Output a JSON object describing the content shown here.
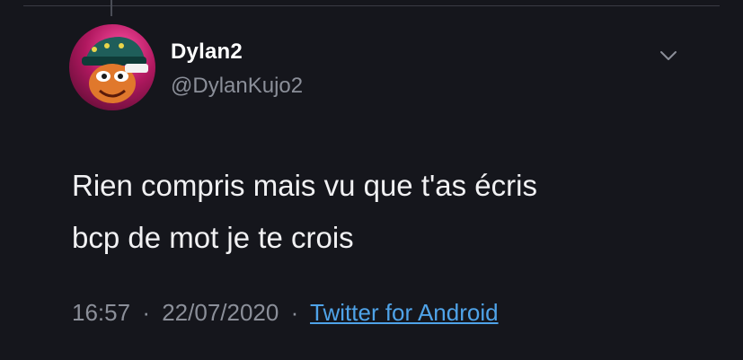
{
  "tweet": {
    "display_name": "Dylan2",
    "handle": "@DylanKujo2",
    "text_line_1": "Rien compris mais vu que t'as écris",
    "text_line_2": "bcp de mot je te crois",
    "time": "16:57",
    "separator": "·",
    "date": "22/07/2020",
    "source": "Twitter for Android"
  },
  "icons": {
    "caret": "chevron-down-icon",
    "avatar": "avatar-image"
  },
  "colors": {
    "background": "#15161c",
    "text": "#f1f1f3",
    "secondary": "#8b8f99",
    "link": "#4fa3e8"
  }
}
